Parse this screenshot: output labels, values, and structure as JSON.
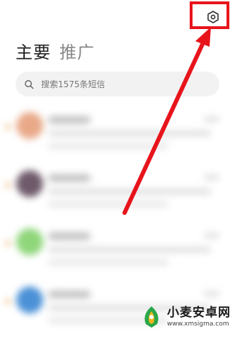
{
  "header": {
    "tabs": [
      {
        "label": "主要",
        "active": true
      },
      {
        "label": "推广",
        "active": false
      }
    ],
    "settings_icon": "settings-hexagon-icon"
  },
  "search": {
    "placeholder": "搜索1575条短信",
    "icon": "search-icon"
  },
  "conversations": [
    {
      "avatar_color": "#e9a989",
      "unread": true
    },
    {
      "avatar_color": "#6e5a6a",
      "unread": true
    },
    {
      "avatar_color": "#8fd67a",
      "unread": true
    },
    {
      "avatar_color": "#4b91d6",
      "unread": true
    }
  ],
  "annotation": {
    "color": "#e8141b"
  },
  "watermark": {
    "title": "小麦安卓网",
    "url": "www.xmsigma.com",
    "logo_colors": [
      "#2aa74a",
      "#f0b51b"
    ]
  }
}
